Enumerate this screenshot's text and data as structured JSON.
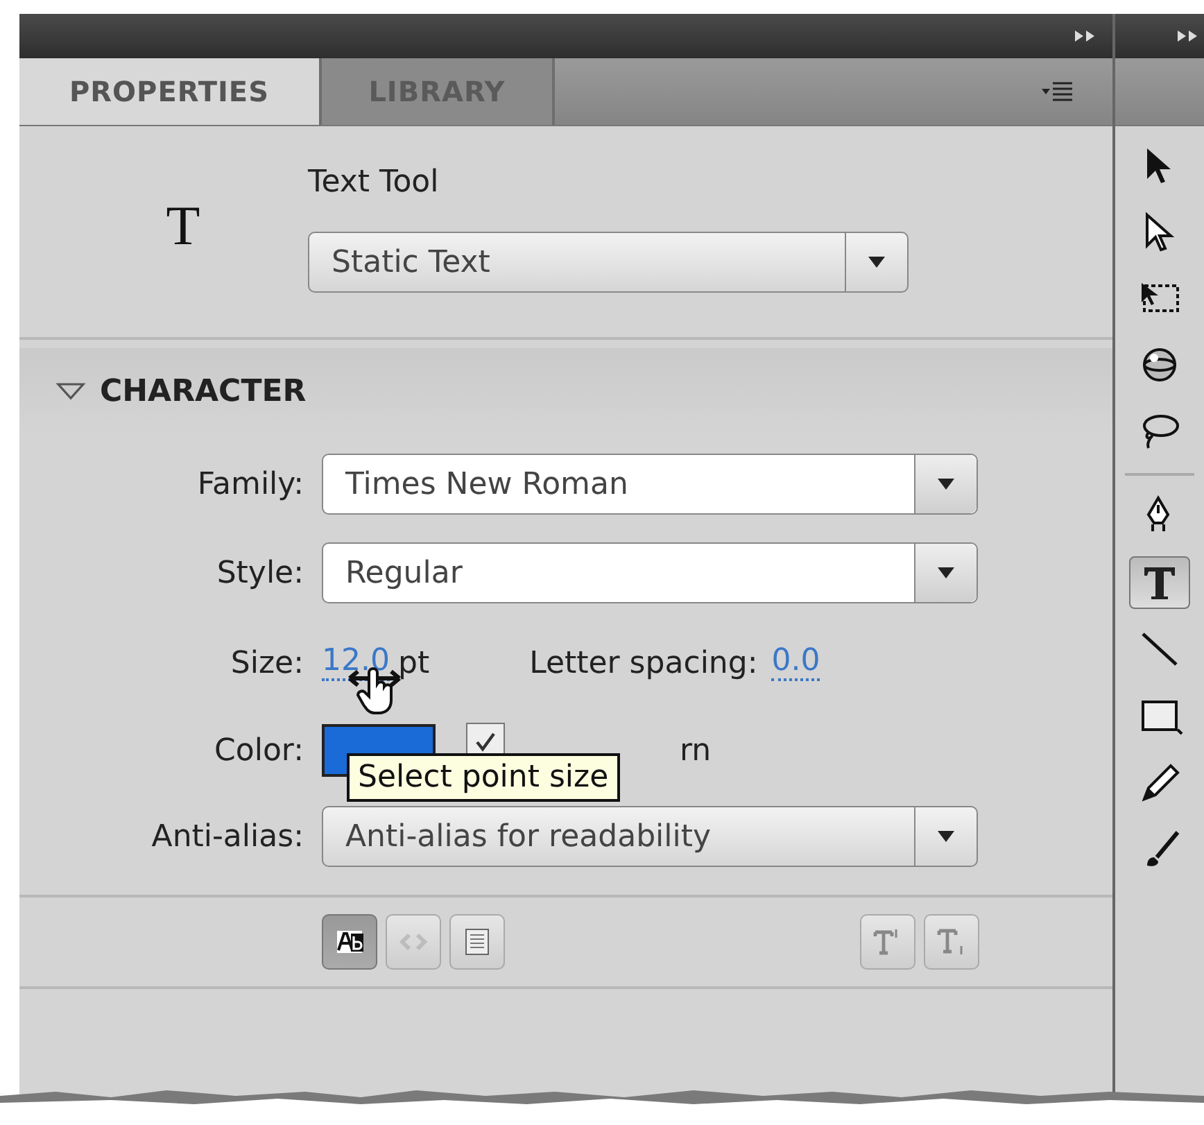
{
  "panel_tabs": [
    {
      "label": "PROPERTIES",
      "selected": true
    },
    {
      "label": "LIBRARY",
      "selected": false
    }
  ],
  "tool": {
    "icon": "T",
    "name": "Text Tool",
    "text_type": "Static Text"
  },
  "section": {
    "title": "CHARACTER",
    "expanded": true
  },
  "family": {
    "label": "Family:",
    "value": "Times New Roman"
  },
  "style": {
    "label": "Style:",
    "value": "Regular"
  },
  "size": {
    "label": "Size:",
    "value": "12.0",
    "unit": "pt"
  },
  "letter_spacing": {
    "label": "Letter spacing:",
    "value": "0.0"
  },
  "color": {
    "label": "Color:",
    "color": "#1a6ad8"
  },
  "auto_kern": {
    "label": "rn",
    "checked": true
  },
  "tooltip": "Select point size",
  "anti_alias": {
    "label": "Anti-alias:",
    "value": "Anti-alias for readability"
  },
  "format_buttons": [
    {
      "kind": "selectable",
      "selected": true,
      "disabled": false
    },
    {
      "kind": "render-html",
      "selected": false,
      "disabled": true
    },
    {
      "kind": "border",
      "selected": false,
      "disabled": false
    }
  ],
  "script_buttons": [
    {
      "kind": "superscript",
      "selected": false
    },
    {
      "kind": "subscript",
      "selected": false
    }
  ],
  "tools": [
    {
      "kind": "selection",
      "selected": false
    },
    {
      "kind": "subselection",
      "selected": false
    },
    {
      "kind": "transform",
      "selected": false
    },
    {
      "kind": "rotate3d",
      "selected": false
    },
    {
      "kind": "lasso",
      "selected": false
    },
    {
      "kind": "pen",
      "selected": false
    },
    {
      "kind": "text",
      "selected": true
    },
    {
      "kind": "line",
      "selected": false
    },
    {
      "kind": "rectangle",
      "selected": false
    },
    {
      "kind": "pencil",
      "selected": false
    },
    {
      "kind": "brush",
      "selected": false
    }
  ]
}
